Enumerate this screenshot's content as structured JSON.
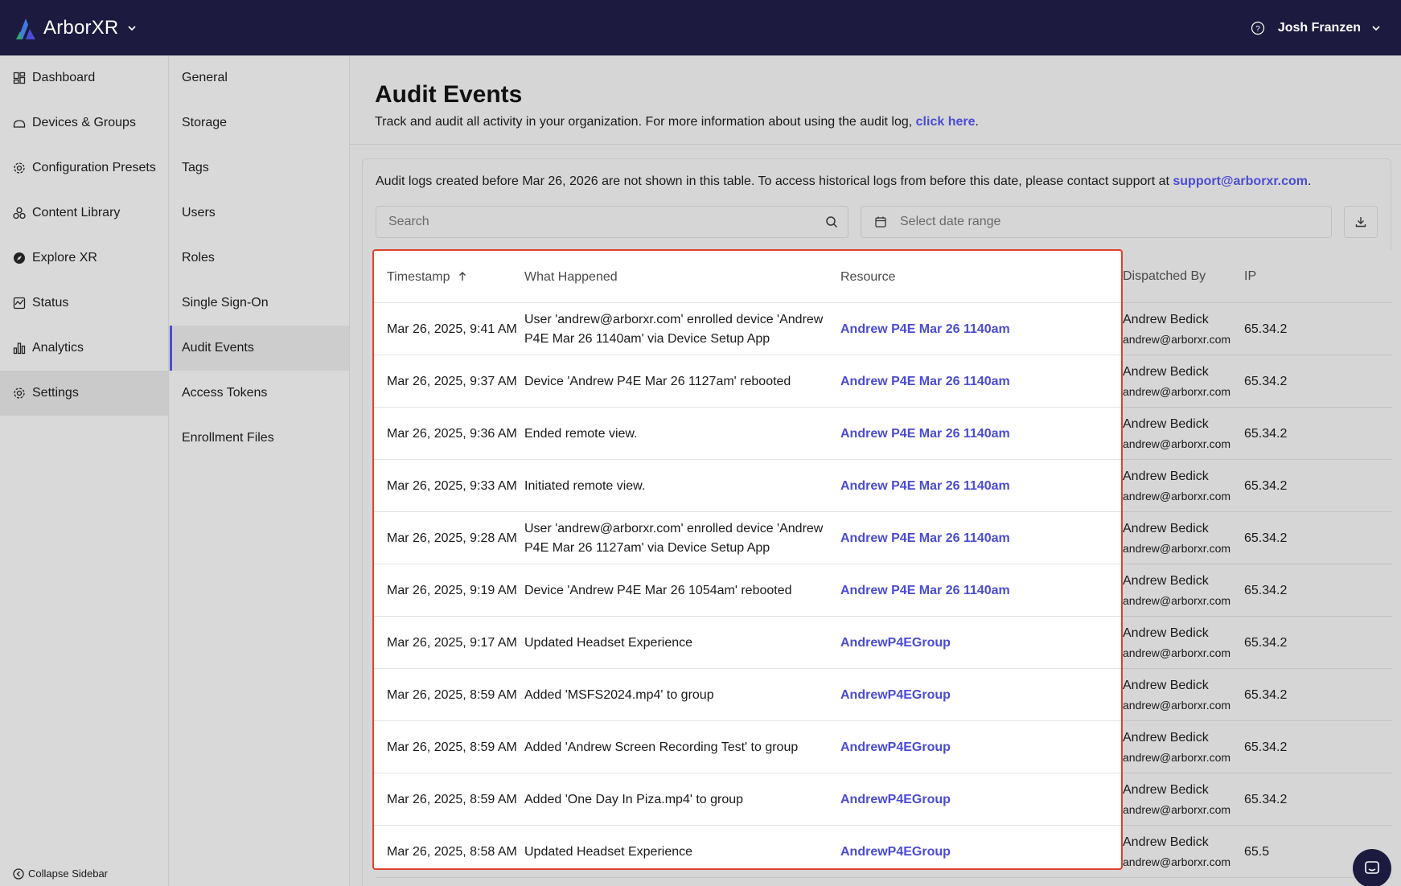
{
  "app": {
    "name": "ArborXR"
  },
  "topbar": {
    "user": "Josh Franzen"
  },
  "main_nav": [
    {
      "label": "Dashboard",
      "icon": "dashboard-icon"
    },
    {
      "label": "Devices & Groups",
      "icon": "devices-icon"
    },
    {
      "label": "Configuration Presets",
      "icon": "gear-icon"
    },
    {
      "label": "Content Library",
      "icon": "content-icon"
    },
    {
      "label": "Explore XR",
      "icon": "compass-icon"
    },
    {
      "label": "Status",
      "icon": "status-icon"
    },
    {
      "label": "Analytics",
      "icon": "analytics-icon"
    },
    {
      "label": "Settings",
      "icon": "gear-icon",
      "active": true
    }
  ],
  "collapse_label": "Collapse Sidebar",
  "sub_nav": [
    {
      "label": "General"
    },
    {
      "label": "Storage"
    },
    {
      "label": "Tags"
    },
    {
      "label": "Users"
    },
    {
      "label": "Roles"
    },
    {
      "label": "Single Sign-On"
    },
    {
      "label": "Audit Events",
      "active": true
    },
    {
      "label": "Access Tokens"
    },
    {
      "label": "Enrollment Files"
    }
  ],
  "page": {
    "title": "Audit Events",
    "subtitle_prefix": "Track and audit all activity in your organization. For more information about using the audit log, ",
    "subtitle_link": "click here",
    "subtitle_suffix": "."
  },
  "notice": {
    "text": "Audit logs created before Mar 26, 2026 are not shown in this table. To access historical logs from before this date, please contact support at ",
    "email": "support@arborxr.com",
    "suffix": "."
  },
  "filters": {
    "search_placeholder": "Search",
    "date_placeholder": "Select date range"
  },
  "table": {
    "columns": {
      "timestamp": "Timestamp",
      "what": "What Happened",
      "resource": "Resource",
      "dispatched_by": "Dispatched By",
      "ip": "IP"
    },
    "rows": [
      {
        "ts": "Mar 26, 2025, 9:41 AM",
        "what": "User 'andrew@arborxr.com' enrolled device 'Andrew P4E Mar 26 1140am' via Device Setup App",
        "resource": "Andrew P4E Mar 26 1140am",
        "by_name": "Andrew Bedick",
        "by_email": "andrew@arborxr.com",
        "ip": "65.34.2"
      },
      {
        "ts": "Mar 26, 2025, 9:37 AM",
        "what": "Device 'Andrew P4E Mar 26 1127am' rebooted",
        "resource": "Andrew P4E Mar 26 1140am",
        "by_name": "Andrew Bedick",
        "by_email": "andrew@arborxr.com",
        "ip": "65.34.2"
      },
      {
        "ts": "Mar 26, 2025, 9:36 AM",
        "what": "Ended remote view.",
        "resource": "Andrew P4E Mar 26 1140am",
        "by_name": "Andrew Bedick",
        "by_email": "andrew@arborxr.com",
        "ip": "65.34.2"
      },
      {
        "ts": "Mar 26, 2025, 9:33 AM",
        "what": "Initiated remote view.",
        "resource": "Andrew P4E Mar 26 1140am",
        "by_name": "Andrew Bedick",
        "by_email": "andrew@arborxr.com",
        "ip": "65.34.2"
      },
      {
        "ts": "Mar 26, 2025, 9:28 AM",
        "what": "User 'andrew@arborxr.com' enrolled device 'Andrew P4E Mar 26 1127am' via Device Setup App",
        "resource": "Andrew P4E Mar 26 1140am",
        "by_name": "Andrew Bedick",
        "by_email": "andrew@arborxr.com",
        "ip": "65.34.2"
      },
      {
        "ts": "Mar 26, 2025, 9:19 AM",
        "what": "Device 'Andrew P4E Mar 26 1054am' rebooted",
        "resource": "Andrew P4E Mar 26 1140am",
        "by_name": "Andrew Bedick",
        "by_email": "andrew@arborxr.com",
        "ip": "65.34.2"
      },
      {
        "ts": "Mar 26, 2025, 9:17 AM",
        "what": "Updated Headset Experience",
        "resource": "AndrewP4EGroup",
        "by_name": "Andrew Bedick",
        "by_email": "andrew@arborxr.com",
        "ip": "65.34.2"
      },
      {
        "ts": "Mar 26, 2025, 8:59 AM",
        "what": "Added 'MSFS2024.mp4' to group",
        "resource": "AndrewP4EGroup",
        "by_name": "Andrew Bedick",
        "by_email": "andrew@arborxr.com",
        "ip": "65.34.2"
      },
      {
        "ts": "Mar 26, 2025, 8:59 AM",
        "what": "Added 'Andrew Screen Recording Test' to group",
        "resource": "AndrewP4EGroup",
        "by_name": "Andrew Bedick",
        "by_email": "andrew@arborxr.com",
        "ip": "65.34.2"
      },
      {
        "ts": "Mar 26, 2025, 8:59 AM",
        "what": "Added 'One Day In Piza.mp4' to group",
        "resource": "AndrewP4EGroup",
        "by_name": "Andrew Bedick",
        "by_email": "andrew@arborxr.com",
        "ip": "65.34.2"
      },
      {
        "ts": "Mar 26, 2025, 8:58 AM",
        "what": "Updated Headset Experience",
        "resource": "AndrewP4EGroup",
        "by_name": "Andrew Bedick",
        "by_email": "andrew@arborxr.com",
        "ip": "65.5"
      }
    ]
  }
}
